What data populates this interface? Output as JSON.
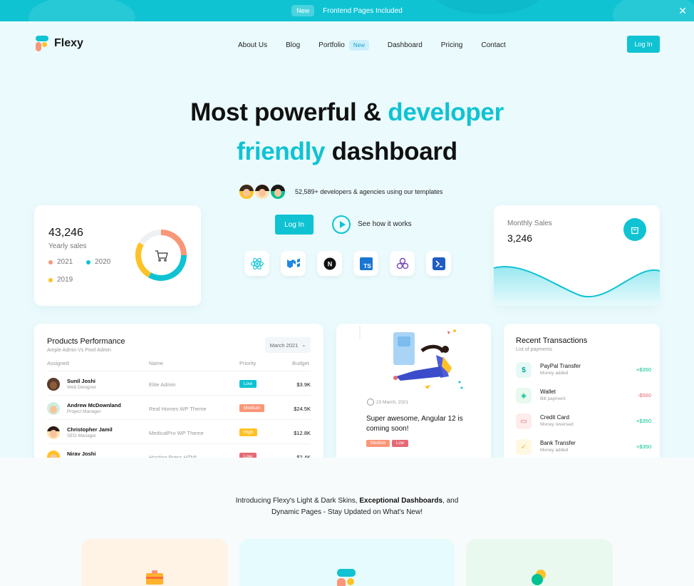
{
  "banner": {
    "badge": "New",
    "text": "Frontend Pages Included",
    "close": "✕"
  },
  "brand": {
    "name": "Flexy",
    "accent": "#0fc3d3"
  },
  "nav": {
    "items": [
      {
        "label": "About Us"
      },
      {
        "label": "Blog"
      },
      {
        "label": "Portfolio",
        "badge": "New"
      },
      {
        "label": "Dashboard"
      },
      {
        "label": "Pricing"
      },
      {
        "label": "Contact"
      }
    ],
    "login": "Log In"
  },
  "hero": {
    "line1_a": "Most powerful &",
    "line1_b": "developer",
    "line2_a": "friendly",
    "line2_b": "dashboard",
    "developers": "52,589+ developers & agencies using our templates",
    "login": "Log In",
    "how": "See how it works",
    "tech_icons": [
      "react-icon",
      "mui-icon",
      "nextjs-icon",
      "typescript-icon",
      "redux-icon",
      "powershell-icon"
    ],
    "ts_label": "TS",
    "next_label": "N"
  },
  "yearly": {
    "value": "43,246",
    "label": "Yearly sales",
    "legend": [
      {
        "label": "2021",
        "color": "#fb9678"
      },
      {
        "label": "2020",
        "color": "#0fc3d3"
      },
      {
        "label": "2019",
        "color": "#ffc226"
      }
    ]
  },
  "monthly": {
    "label": "Monthly Sales",
    "value": "3,246"
  },
  "products": {
    "title": "Products Performance",
    "subtitle": "Ample Admin Vs Pixel Admin",
    "select": "March 2021",
    "headers": [
      "Assigned",
      "Name",
      "Priority",
      "Budget"
    ],
    "rows": [
      {
        "name": "Sunil Joshi",
        "role": "Web Designer",
        "project": "Elite Admin",
        "priority": "Low",
        "color": "#0fc3d3",
        "budget": "$3.9K"
      },
      {
        "name": "Andrew McDownland",
        "role": "Project Manager",
        "project": "Real Homes WP Theme",
        "priority": "Medium",
        "color": "#fb9678",
        "budget": "$24.5K"
      },
      {
        "name": "Christopher Jamil",
        "role": "SEO Manager",
        "project": "MedicalPro WP Theme",
        "priority": "High",
        "color": "#ffc226",
        "budget": "$12.8K"
      },
      {
        "name": "Nirav Joshi",
        "role": "Frontend Engineer",
        "project": "Hosting Press HTML",
        "priority": "Low",
        "color": "#e46a76",
        "budget": "$2.4K"
      }
    ]
  },
  "blog": {
    "date": "23 March, 2021",
    "title": "Super awesome, Angular 12 is coming soon!",
    "tags": [
      {
        "label": "Medium",
        "color": "#fb9678"
      },
      {
        "label": "Low",
        "color": "#e46a76"
      }
    ]
  },
  "transactions": {
    "title": "Recent Transactions",
    "subtitle": "List of payments",
    "items": [
      {
        "name": "PayPal Transfer",
        "sub": "Money added",
        "amount": "+$350",
        "amount_color": "#00c292",
        "icon": "dollar-icon",
        "glyph": "$",
        "bg": "#e6f9f7",
        "fg": "#00a9a0"
      },
      {
        "name": "Wallet",
        "sub": "Bill payment",
        "amount": "-$560",
        "amount_color": "#e46a76",
        "icon": "shield-icon",
        "glyph": "◈",
        "bg": "#e8f9ef",
        "fg": "#00c292"
      },
      {
        "name": "Credit Card",
        "sub": "Money reversed",
        "amount": "+$350",
        "amount_color": "#00c292",
        "icon": "credit-card-icon",
        "glyph": "▭",
        "bg": "#fdeceb",
        "fg": "#e46a76"
      },
      {
        "name": "Bank Transfer",
        "sub": "Money added",
        "amount": "+$350",
        "amount_color": "#00c292",
        "icon": "check-icon",
        "glyph": "✓",
        "bg": "#fff8e1",
        "fg": "#ffb22b"
      }
    ]
  },
  "intro": {
    "a": "Introducing Flexy's Light & Dark Skins,",
    "b": "Exceptional Dashboards",
    "c": ", and",
    "d": "Dynamic Pages - Stay Updated on What's New!"
  }
}
